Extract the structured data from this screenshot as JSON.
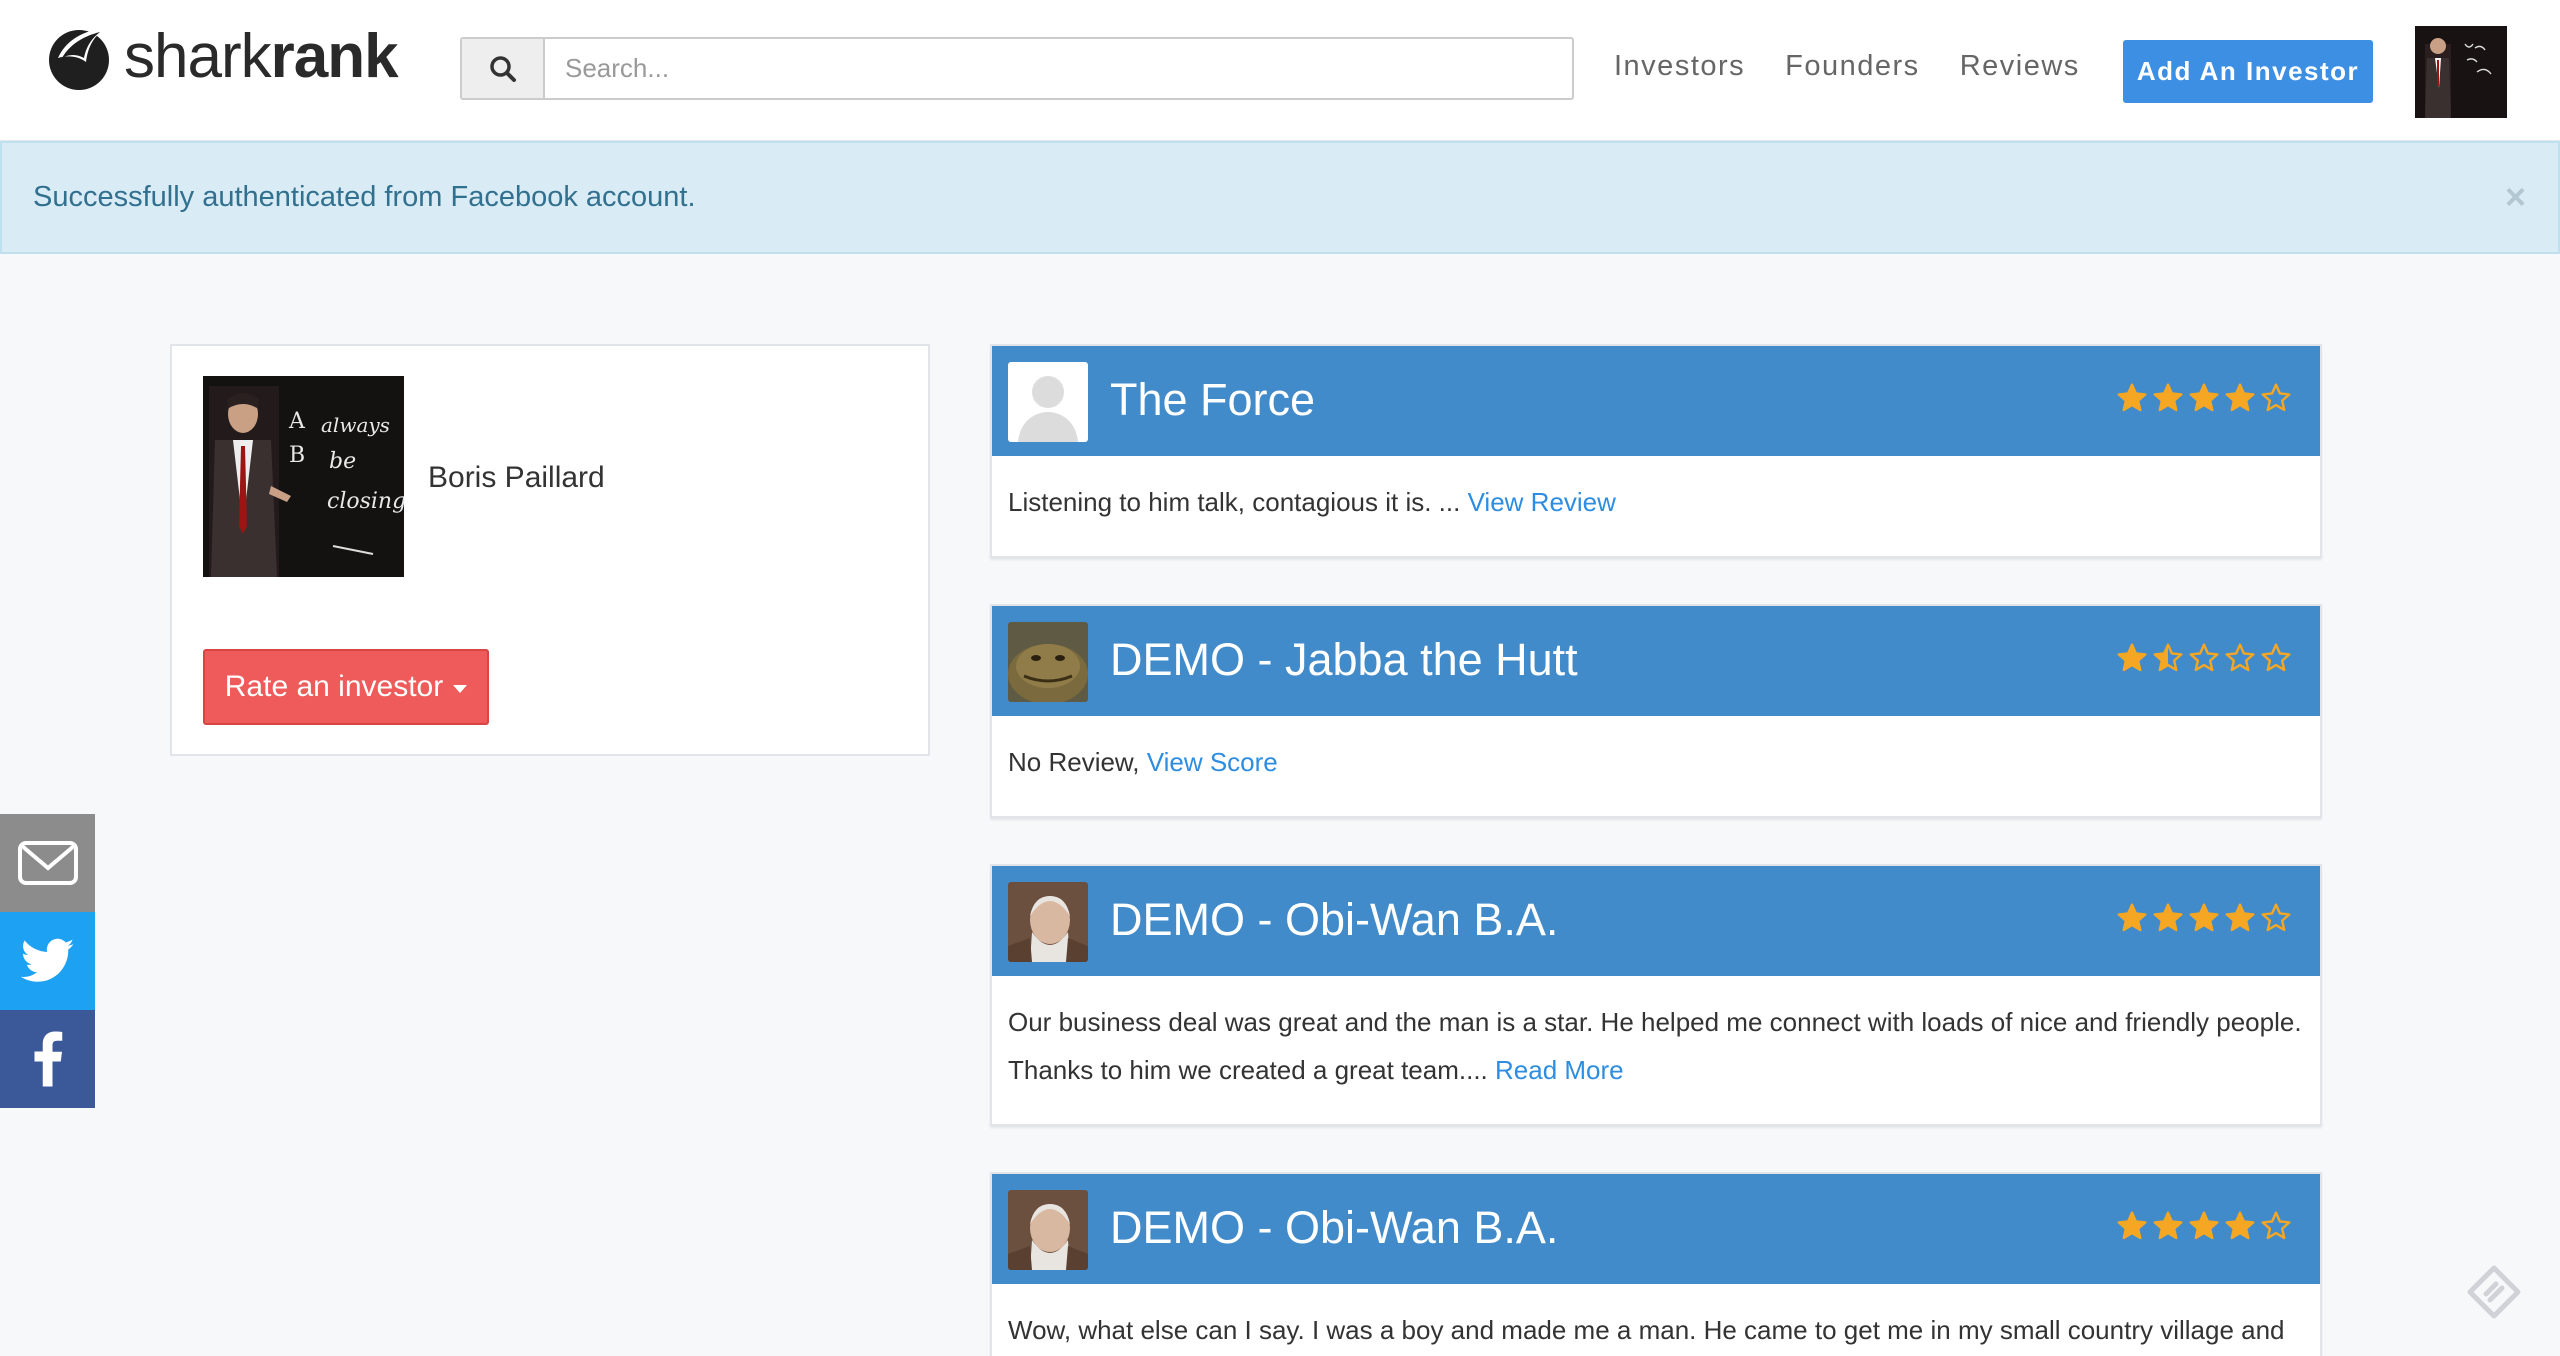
{
  "brand": {
    "name_light": "shark",
    "name_bold": "rank"
  },
  "search": {
    "placeholder": "Search...",
    "value": ""
  },
  "nav": {
    "links": [
      "Investors",
      "Founders",
      "Reviews"
    ],
    "add_button": "Add An Investor"
  },
  "alert": {
    "message": "Successfully authenticated from Facebook account.",
    "close": "×"
  },
  "profile": {
    "name": "Boris Paillard",
    "rate_button": "Rate an investor",
    "photo_caption": [
      "A",
      "always",
      "B",
      "be",
      "closing"
    ]
  },
  "share": [
    "email-icon",
    "twitter-icon",
    "facebook-icon"
  ],
  "colors": {
    "primary": "#428bca",
    "add_button": "#3d8fe3",
    "rate_button": "#ef5b5b",
    "star": "#f5a623",
    "link": "#2e8de0",
    "alert_bg": "#d9ecf5",
    "alert_text": "#31708f",
    "twitter": "#1da1f2",
    "facebook": "#3b5998",
    "email": "#8c8c8c"
  },
  "reviews": [
    {
      "title": "The Force",
      "avatar": "default-user-avatar",
      "rating": 4,
      "body": "Listening to him talk, contagious it is. ... ",
      "link": "View Review",
      "body_after": ""
    },
    {
      "title": "DEMO - Jabba the Hutt",
      "avatar": "jabba-avatar",
      "rating": 1.5,
      "body": "No Review, ",
      "link": "View Score",
      "body_after": ""
    },
    {
      "title": "DEMO - Obi-Wan B.A.",
      "avatar": "obi-wan-avatar",
      "rating": 4,
      "body": "Our business deal was great and the man is a star. He helped me connect with loads of nice and friendly people. Thanks to him we created a great team.... ",
      "link": "Read More",
      "body_after": ""
    },
    {
      "title": "DEMO - Obi-Wan B.A.",
      "avatar": "obi-wan-avatar",
      "rating": 4,
      "body": "Wow, what else can I say. I was a boy and made me a man. He came to get me in my small country village and",
      "link": "",
      "body_after": ""
    }
  ]
}
